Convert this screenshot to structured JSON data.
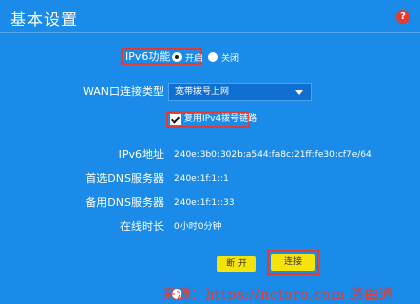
{
  "header": {
    "title": "基本设置",
    "help_icon_glyph": "?"
  },
  "ipv6": {
    "label": "IPv6功能",
    "option_on": "开启",
    "option_off": "关闭",
    "selected": "开启"
  },
  "wan_type": {
    "label": "WAN口连接类型",
    "value": "宽带拨号上网"
  },
  "reuse_pppoe": {
    "label": "复用IPv4拨号链路",
    "checked": true
  },
  "info": [
    {
      "label": "IPv6地址",
      "value": "240e:3b0:302b:a544:fa8c:21ff:fe30:cf7e/64"
    },
    {
      "label": "首选DNS服务器",
      "value": "240e:1f:1::1"
    },
    {
      "label": "备用DNS服务器",
      "value": "240e:1f:1::33"
    },
    {
      "label": "在线时长",
      "value": "0小时0分钟"
    }
  ],
  "buttons": {
    "disconnect": "断 开",
    "connect": "连接"
  },
  "watermark": "来源：https://nctoro.com 路由通",
  "colors": {
    "background": "#1a8be8",
    "button": "#f5e30c",
    "highlight": "#e8392f"
  }
}
